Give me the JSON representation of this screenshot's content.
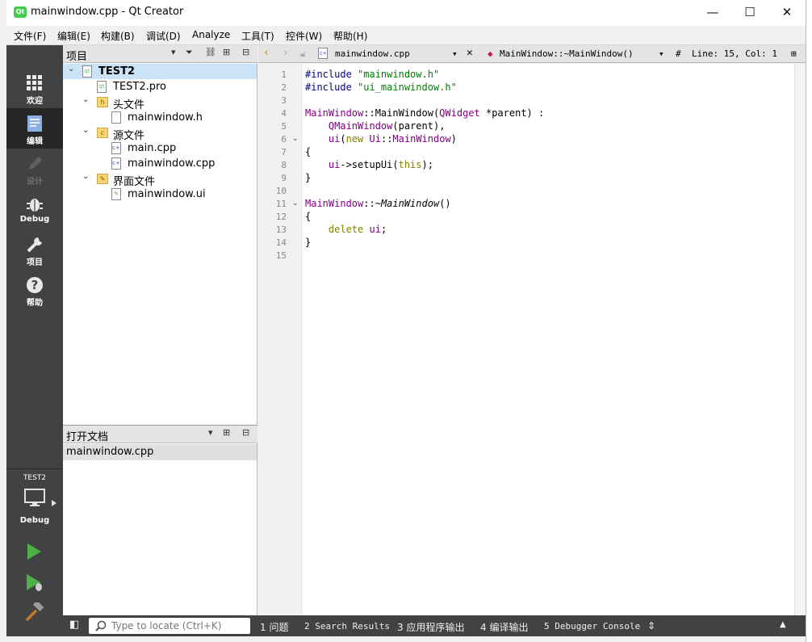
{
  "window": {
    "title": "mainwindow.cpp - Qt Creator",
    "app_icon_label": "Qt",
    "controls": {
      "minimize": "—",
      "maximize": "☐",
      "close": "✕"
    }
  },
  "menubar": {
    "items": [
      "文件(F)",
      "编辑(E)",
      "构建(B)",
      "调试(D)",
      "Analyze",
      "工具(T)",
      "控件(W)",
      "帮助(H)"
    ]
  },
  "modebar": {
    "modes": [
      {
        "label": "欢迎",
        "icon": "grid-icon",
        "active": false,
        "enabled": true
      },
      {
        "label": "编辑",
        "icon": "edit-doc-icon",
        "active": true,
        "enabled": true
      },
      {
        "label": "设计",
        "icon": "pencil-icon",
        "active": false,
        "enabled": false
      },
      {
        "label": "Debug",
        "icon": "bug-icon",
        "active": false,
        "enabled": true
      },
      {
        "label": "项目",
        "icon": "wrench-icon",
        "active": false,
        "enabled": true
      },
      {
        "label": "帮助",
        "icon": "help-icon",
        "active": false,
        "enabled": true
      }
    ],
    "target": {
      "project": "TEST2",
      "build_mode": "Debug"
    },
    "actions": [
      "run-icon",
      "debug-run-icon",
      "build-hammer-icon"
    ]
  },
  "project_panel": {
    "title": "项目",
    "tree": [
      {
        "label": "TEST2",
        "level": 0,
        "expanded": true,
        "bold": true,
        "icon": "project-icon",
        "selected": true
      },
      {
        "label": "TEST2.pro",
        "level": 1,
        "icon": "pro-file-icon"
      },
      {
        "label": "头文件",
        "level": 1,
        "expanded": true,
        "icon": "headers-folder-icon"
      },
      {
        "label": "mainwindow.h",
        "level": 2,
        "icon": "h-file-icon"
      },
      {
        "label": "源文件",
        "level": 1,
        "expanded": true,
        "icon": "sources-folder-icon"
      },
      {
        "label": "main.cpp",
        "level": 2,
        "icon": "cpp-file-icon"
      },
      {
        "label": "mainwindow.cpp",
        "level": 2,
        "icon": "cpp-file-icon"
      },
      {
        "label": "界面文件",
        "level": 1,
        "expanded": true,
        "icon": "forms-folder-icon"
      },
      {
        "label": "mainwindow.ui",
        "level": 2,
        "icon": "ui-file-icon"
      }
    ]
  },
  "open_docs_panel": {
    "title": "打开文档",
    "docs": [
      "mainwindow.cpp"
    ]
  },
  "editor_toolbar": {
    "file": "mainwindow.cpp",
    "symbol": "MainWindow::~MainWindow()",
    "hash": "#",
    "position": "Line: 15, Col: 1"
  },
  "editor": {
    "line_count": 15,
    "fold_lines": [
      6,
      11
    ],
    "lines": [
      [
        [
          "#include ",
          "kw-pre"
        ],
        [
          "\"mainwindow.h\"",
          "str"
        ]
      ],
      [
        [
          "#include ",
          "kw-pre"
        ],
        [
          "\"ui_mainwindow.h\"",
          "str"
        ]
      ],
      [],
      [
        [
          "MainWindow",
          "cls"
        ],
        [
          "::MainWindow(",
          ""
        ],
        [
          "QWidget",
          "cls"
        ],
        [
          " *parent) :",
          ""
        ]
      ],
      [
        [
          "    ",
          ""
        ],
        [
          "QMainWindow",
          "cls"
        ],
        [
          "(parent),",
          ""
        ]
      ],
      [
        [
          "    ",
          ""
        ],
        [
          "ui",
          "cls"
        ],
        [
          "(",
          ""
        ],
        [
          "new",
          "kw"
        ],
        [
          " ",
          ""
        ],
        [
          "Ui",
          "cls"
        ],
        [
          "::",
          ""
        ],
        [
          "MainWindow",
          "cls"
        ],
        [
          ")",
          ""
        ]
      ],
      [
        [
          "{",
          ""
        ]
      ],
      [
        [
          "    ",
          ""
        ],
        [
          "ui",
          "cls"
        ],
        [
          "->setupUi(",
          ""
        ],
        [
          "this",
          "kw"
        ],
        [
          ");",
          ""
        ]
      ],
      [
        [
          "}",
          ""
        ]
      ],
      [],
      [
        [
          "MainWindow",
          "cls"
        ],
        [
          "::~",
          ""
        ],
        [
          "MainWindow",
          "ital"
        ],
        [
          "()",
          ""
        ]
      ],
      [
        [
          "{",
          ""
        ]
      ],
      [
        [
          "    ",
          ""
        ],
        [
          "delete",
          "kw"
        ],
        [
          " ",
          ""
        ],
        [
          "ui",
          "cls"
        ],
        [
          ";",
          ""
        ]
      ],
      [
        [
          "}",
          ""
        ]
      ],
      []
    ]
  },
  "statusbar": {
    "locator_placeholder": "Type to locate (Ctrl+K)",
    "panes": [
      "1 问题",
      "2 Search Results",
      "3 应用程序输出",
      "4 编译输出",
      "5 Debugger Console"
    ]
  },
  "colors": {
    "modebar": "#404244",
    "mode_active": "#262626",
    "keyword": "#808000",
    "class": "#800080",
    "string": "#008000",
    "preprocessor": "#000080"
  }
}
